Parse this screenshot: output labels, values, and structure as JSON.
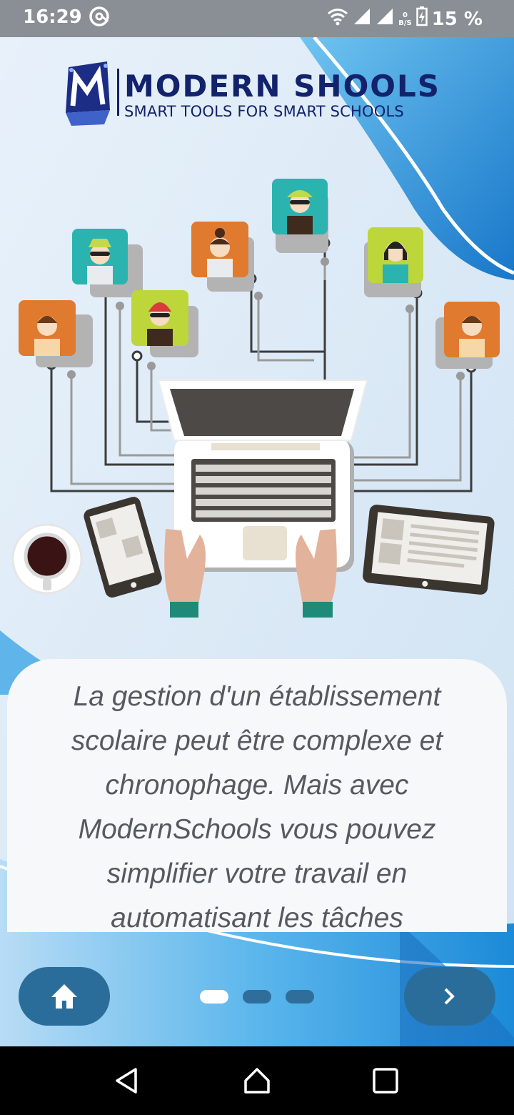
{
  "status_bar": {
    "time": "16:29",
    "battery": "15 %",
    "data_rate_top": "0",
    "data_rate_unit": "B/S",
    "icons": [
      "at-sign-icon",
      "wifi-icon",
      "signal-icon",
      "signal-icon",
      "battery-charging-icon"
    ]
  },
  "logo": {
    "brand": "MODERN SHOOLS",
    "tagline": "SMART TOOLS FOR SMART SCHOOLS",
    "mark_letter": "M"
  },
  "card": {
    "text": "La gestion d'un établissement scolaire peut être complexe et chronophage. Mais avec ModernSchools vous pouvez simplifier votre travail en automatisant les tâches"
  },
  "pager": {
    "count": 3,
    "active_index": 0
  },
  "controls": {
    "home_icon": "home-icon",
    "next_icon": "chevron-right-icon"
  },
  "nav_bar": {
    "icons": [
      "back-triangle-icon",
      "home-circle-icon",
      "recents-square-icon"
    ]
  },
  "colors": {
    "brand_navy": "#12226b",
    "accent_blue": "#2b6d9a",
    "card_text": "#555a60"
  }
}
